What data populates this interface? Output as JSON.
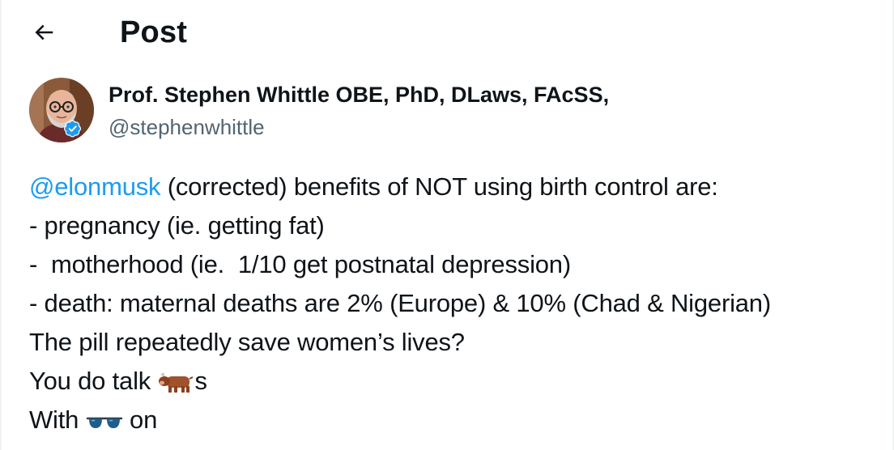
{
  "header": {
    "back_icon": "arrow-left-icon",
    "title": "Post"
  },
  "author": {
    "name": "Prof. Stephen Whittle OBE, PhD, DLaws, FAcSS,",
    "handle": "@stephenwhittle",
    "verified_icon": "verified-badge-icon",
    "verified_color": "#1d9bf0"
  },
  "tweet": {
    "mention": "@elonmusk",
    "line1_rest": " (corrected) benefits of NOT using birth control are:",
    "line2": "- pregnancy (ie. getting fat)",
    "line3": "-  motherhood (ie.  1/10 get postnatal depression)",
    "line4": "- death: maternal deaths are 2% (Europe) & 10% (Chad & Nigerian)",
    "line5": "The pill repeatedly save women’s lives?",
    "line6_before": "You do talk ",
    "line6_emoji": "ox-emoji",
    "line6_after": "s",
    "line7_before": "With ",
    "line7_emoji": "sunglasses-emoji",
    "line7_after": " on"
  },
  "colors": {
    "link": "#1d9bf0",
    "secondary_text": "#536471",
    "primary_text": "#0f1419"
  }
}
